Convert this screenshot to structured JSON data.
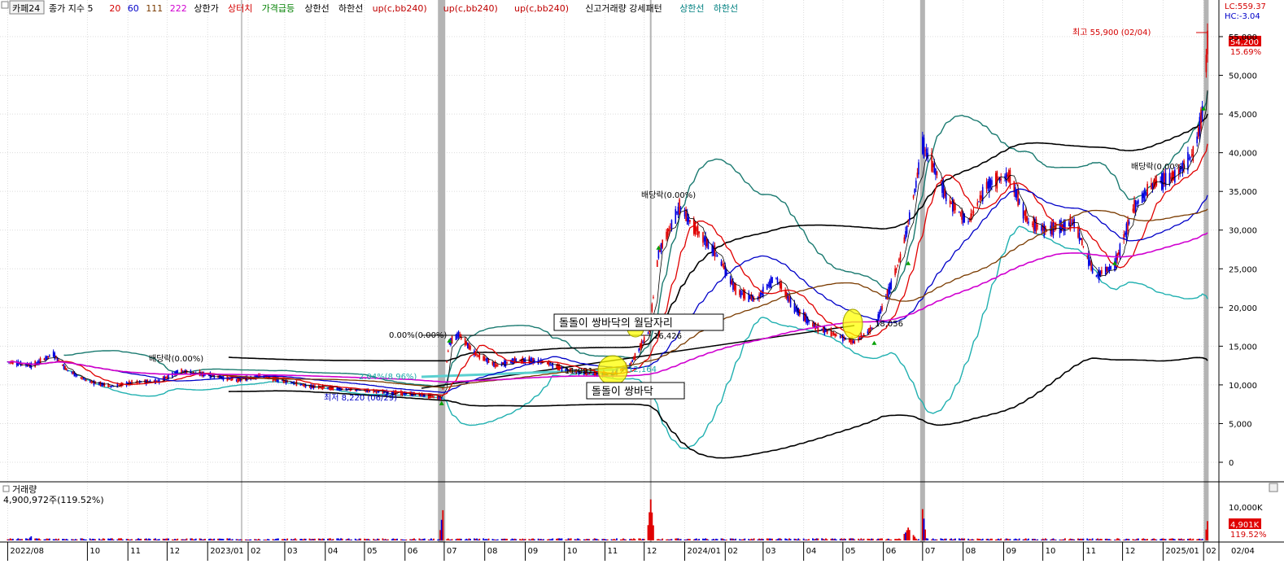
{
  "header": {
    "title": "카페24",
    "items": [
      {
        "text": "종가 지수 5",
        "color": "#000000"
      },
      {
        "text": "20",
        "color": "#d40000"
      },
      {
        "text": "60",
        "color": "#0000c8"
      },
      {
        "text": "111",
        "color": "#7a3b00"
      },
      {
        "text": "222",
        "color": "#d000d0"
      },
      {
        "text": "상한가",
        "color": "#000000"
      },
      {
        "text": "상터치",
        "color": "#d40000"
      },
      {
        "text": "가격급등",
        "color": "#008000"
      },
      {
        "text": "상한선",
        "color": "#000000"
      },
      {
        "text": "하한선",
        "color": "#000000"
      },
      {
        "text": "up(c,bb240)",
        "color": "#c00000"
      },
      {
        "text": "up(c,bb240)",
        "color": "#c00000"
      },
      {
        "text": "up(c,bb240)",
        "color": "#c00000"
      },
      {
        "text": "신고거래량 강세패턴",
        "color": "#000000"
      },
      {
        "text": "상한선",
        "color": "#008080"
      },
      {
        "text": "하한선",
        "color": "#008080"
      }
    ],
    "lc": "LC:559.37",
    "hc": "HC:-3.04"
  },
  "price_axis": {
    "current_price": "54,200",
    "current_pct": "15.69%"
  },
  "annotations": {
    "high": "최고 55,900 (02/04)",
    "low": "최저 8,220 (06/29)",
    "dividend1": "배당락(0.00%)",
    "dividend2": "배당락(0.00%)",
    "dividend3": "배당락(0.00%)",
    "pct_zero": "0.00%(0.00%)",
    "pct_teal": "2.04%(8.96%)",
    "val_11091": "11,091",
    "val_12164": "12,164",
    "val_16426": "16,426",
    "val_18056": "18,056",
    "box1": "돌돌이 쌍바닥의 월담자리",
    "box2": "돌돌이 쌍바닥"
  },
  "volume_panel": {
    "title": "거래량",
    "value": "4,900,972주(119.52%)",
    "axis_label": "10,000K",
    "current": "4,901K",
    "current_pct": "119.52%"
  },
  "chart_data": {
    "type": "candlestick",
    "y_ticks": [
      0,
      5000,
      10000,
      15000,
      20000,
      25000,
      30000,
      35000,
      40000,
      45000,
      50000,
      55000
    ],
    "y_tick_labels": [
      "0",
      "5,000",
      "10,000",
      "15,000",
      "20,000",
      "25,000",
      "30,000",
      "35,000",
      "40,000",
      "45,000",
      "50,000",
      "55,000"
    ],
    "x_labels": [
      "2022/08",
      "10",
      "11",
      "12",
      "2023/01",
      "02",
      "03",
      "04",
      "05",
      "06",
      "07",
      "08",
      "09",
      "10",
      "11",
      "12",
      "2024/01",
      "02",
      "03",
      "04",
      "05",
      "06",
      "07",
      "08",
      "09",
      "10",
      "11",
      "12",
      "2025/01",
      "02",
      "02/04"
    ],
    "close_trace": [
      [
        "2022-08-01",
        13000
      ],
      [
        "2022-08-20",
        12500
      ],
      [
        "2022-09-05",
        14000
      ],
      [
        "2022-09-15",
        12000
      ],
      [
        "2022-10-01",
        10500
      ],
      [
        "2022-10-20",
        9800
      ],
      [
        "2022-11-05",
        10300
      ],
      [
        "2022-11-25",
        10500
      ],
      [
        "2022-12-10",
        11800
      ],
      [
        "2023-01-05",
        11200
      ],
      [
        "2023-01-25",
        10600
      ],
      [
        "2023-02-10",
        11200
      ],
      [
        "2023-03-01",
        10500
      ],
      [
        "2023-03-20",
        9800
      ],
      [
        "2023-04-10",
        9500
      ],
      [
        "2023-05-01",
        9300
      ],
      [
        "2023-05-20",
        9000
      ],
      [
        "2023-06-10",
        8800
      ],
      [
        "2023-06-29",
        8300
      ],
      [
        "2023-07-05",
        15500
      ],
      [
        "2023-07-12",
        16500
      ],
      [
        "2023-07-25",
        14000
      ],
      [
        "2023-08-10",
        12500
      ],
      [
        "2023-08-25",
        13200
      ],
      [
        "2023-09-15",
        13000
      ],
      [
        "2023-10-01",
        12000
      ],
      [
        "2023-10-20",
        11500
      ],
      [
        "2023-11-05",
        11300
      ],
      [
        "2023-11-20",
        12500
      ],
      [
        "2023-12-05",
        17000
      ],
      [
        "2023-12-12",
        27000
      ],
      [
        "2023-12-20",
        30000
      ],
      [
        "2023-12-28",
        33000
      ],
      [
        "2024-01-10",
        30000
      ],
      [
        "2024-01-25",
        27000
      ],
      [
        "2024-02-10",
        22000
      ],
      [
        "2024-02-25",
        21000
      ],
      [
        "2024-03-10",
        24000
      ],
      [
        "2024-03-25",
        20000
      ],
      [
        "2024-04-10",
        17500
      ],
      [
        "2024-04-25",
        16500
      ],
      [
        "2024-05-10",
        15500
      ],
      [
        "2024-05-25",
        17500
      ],
      [
        "2024-06-05",
        22000
      ],
      [
        "2024-06-15",
        27000
      ],
      [
        "2024-06-25",
        35000
      ],
      [
        "2024-07-01",
        41000
      ],
      [
        "2024-07-10",
        38000
      ],
      [
        "2024-07-20",
        34000
      ],
      [
        "2024-08-05",
        31000
      ],
      [
        "2024-08-20",
        36000
      ],
      [
        "2024-09-05",
        37000
      ],
      [
        "2024-09-20",
        31000
      ],
      [
        "2024-10-05",
        30000
      ],
      [
        "2024-10-25",
        31000
      ],
      [
        "2024-11-10",
        24000
      ],
      [
        "2024-11-25",
        25500
      ],
      [
        "2024-12-10",
        33000
      ],
      [
        "2024-12-25",
        36000
      ],
      [
        "2025-01-10",
        37000
      ],
      [
        "2025-01-25",
        40000
      ],
      [
        "2025-02-01",
        46000
      ],
      [
        "2025-02-04",
        54200
      ]
    ],
    "high": 55900,
    "low": 8220
  }
}
